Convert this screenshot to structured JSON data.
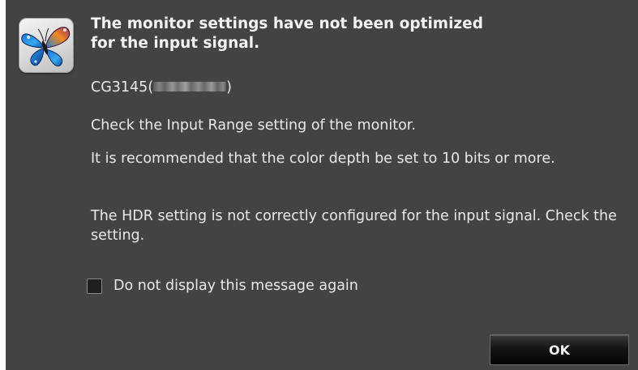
{
  "dialog": {
    "title": "The monitor settings have not been optimized\nfor the input signal.",
    "model_prefix": "CG3145(",
    "model_suffix": ")",
    "messages": [
      "Check the Input Range setting of the monitor.",
      "It is recommended that the color depth be set to 10 bits or more.",
      "The HDR setting is not correctly configured for the input signal. Check the setting."
    ],
    "checkbox_label": "Do not display this message again",
    "checkbox_checked": false,
    "ok_label": "OK",
    "icon": "butterfly-icon"
  },
  "colors": {
    "background": "#434343",
    "text": "#e9e9e9",
    "button": "#0a0a0a"
  }
}
